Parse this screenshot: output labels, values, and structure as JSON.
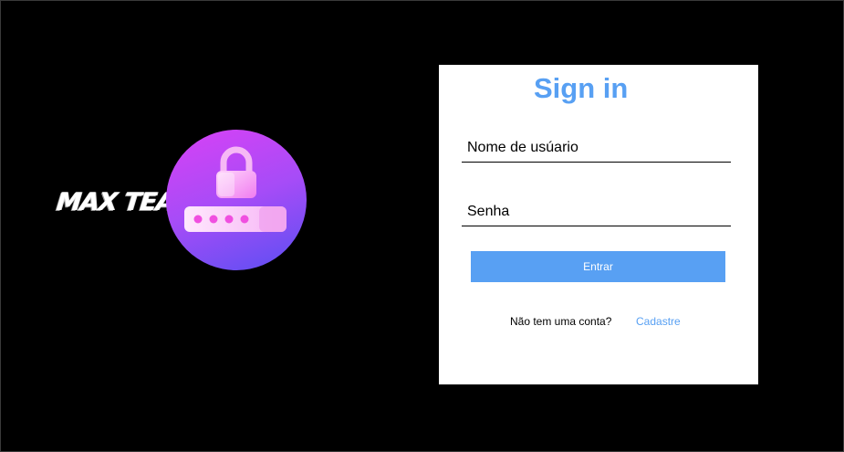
{
  "brand": {
    "logo_text": "MAX TEAM"
  },
  "login_card": {
    "title": "Sign in",
    "username_placeholder": "Nome de usúario",
    "password_placeholder": "Senha",
    "submit_label": "Entrar",
    "no_account_text": "Não tem uma conta?",
    "signup_link": "Cadastre"
  },
  "colors": {
    "background": "#000000",
    "card": "#ffffff",
    "accent": "#58a0f3",
    "logo_gradient": [
      "#d941f5",
      "#a64cf7",
      "#5b4ff2"
    ]
  },
  "icons": {
    "logo": "lock-password-icon"
  }
}
